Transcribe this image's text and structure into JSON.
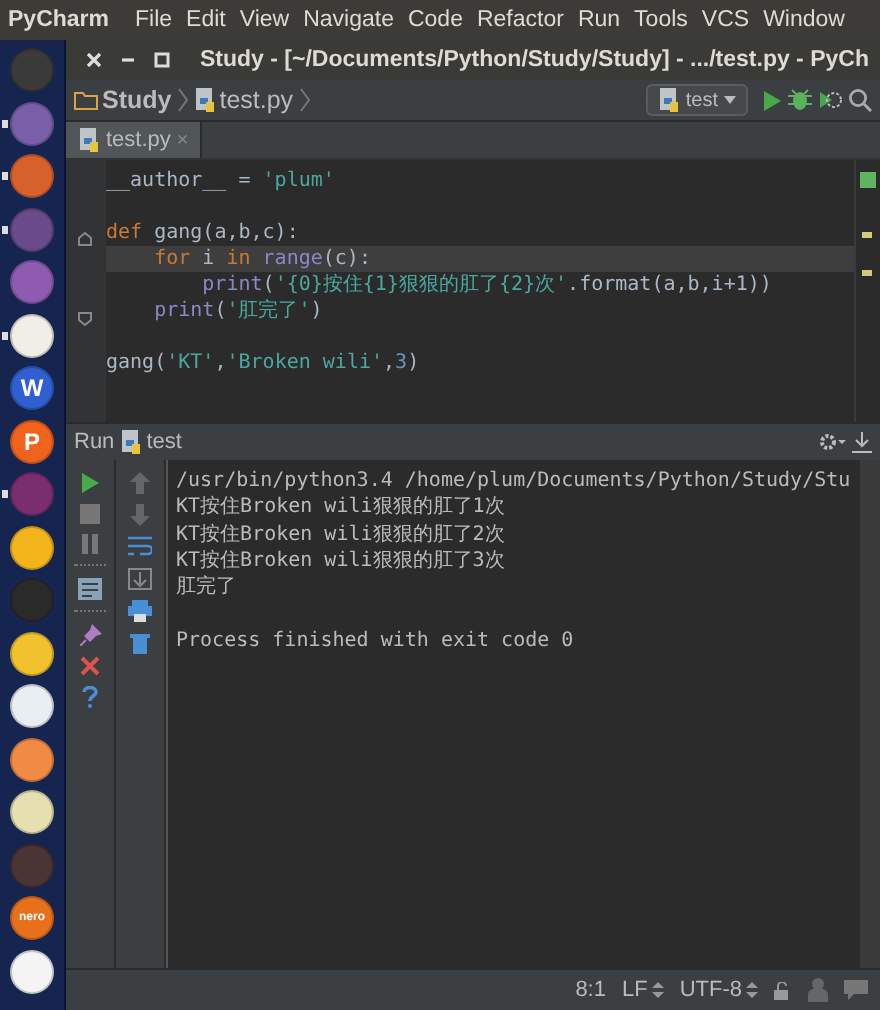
{
  "menu_bar": {
    "app": "PyCharm",
    "items": [
      "File",
      "Edit",
      "View",
      "Navigate",
      "Code",
      "Refactor",
      "Run",
      "Tools",
      "VCS",
      "Window"
    ]
  },
  "launcher": [
    {
      "color": "#3a3a3a",
      "running": false
    },
    {
      "color": "#7a5fa8",
      "running": true
    },
    {
      "color": "#d8602a",
      "running": true
    },
    {
      "color": "#6a4a8a",
      "running": true
    },
    {
      "color": "#8e5bb0",
      "running": false
    },
    {
      "color": "#efefe6",
      "running": true
    },
    {
      "color": "#2f5fd0",
      "glyph": "W",
      "running": false
    },
    {
      "color": "#f0631c",
      "glyph": "P",
      "running": false
    },
    {
      "color": "#7a2e6e",
      "running": true
    },
    {
      "color": "#f3b51c",
      "running": false
    },
    {
      "color": "#2a2a2a",
      "running": false
    },
    {
      "color": "#f2c12e",
      "running": false
    },
    {
      "color": "#e8eef2",
      "running": false
    },
    {
      "color": "#f08a44",
      "running": false
    },
    {
      "color": "#e6dfb0",
      "running": false
    },
    {
      "color": "#4a3434",
      "running": false
    },
    {
      "color": "#e8701a",
      "glyph": "nero",
      "running": false
    },
    {
      "color": "#f4f4f4",
      "running": false
    }
  ],
  "window": {
    "title": "Study - [~/Documents/Python/Study/Study] - .../test.py - PyCh"
  },
  "breadcrumbs": [
    "Study",
    "test.py"
  ],
  "run_config": "test",
  "tabs": [
    {
      "label": "test.py",
      "close": "×",
      "selected": true
    }
  ],
  "editor": {
    "blocks": [
      [
        {
          "current": false,
          "tokens": [
            {
              "kind": "plain",
              "text": "__author__ = "
            },
            {
              "kind": "string",
              "text": "'plum'"
            }
          ]
        }
      ],
      [
        {
          "current": false,
          "tokens": [
            {
              "kind": "keyword",
              "text": "def "
            },
            {
              "kind": "plain",
              "text": "gang(a,b,c):"
            }
          ]
        },
        {
          "current": true,
          "tokens": [
            {
              "kind": "keyword",
              "text": "    for "
            },
            {
              "kind": "plain",
              "text": "i "
            },
            {
              "kind": "keyword",
              "text": "in "
            },
            {
              "kind": "builtin",
              "text": "range"
            },
            {
              "kind": "plain",
              "text": "(c):"
            }
          ]
        },
        {
          "current": false,
          "tokens": [
            {
              "kind": "builtin",
              "text": "        print"
            },
            {
              "kind": "plain",
              "text": "("
            },
            {
              "kind": "string",
              "text": "'{0}按住{1}狠狠的肛了{2}次'"
            },
            {
              "kind": "plain",
              "text": ".format(a,b,i+1))"
            }
          ]
        },
        {
          "current": false,
          "tokens": [
            {
              "kind": "builtin",
              "text": "    print"
            },
            {
              "kind": "plain",
              "text": "("
            },
            {
              "kind": "string",
              "text": "'肛完了'"
            },
            {
              "kind": "plain",
              "text": ")"
            }
          ]
        }
      ],
      [
        {
          "current": false,
          "tokens": [
            {
              "kind": "plain",
              "text": "gang("
            },
            {
              "kind": "string",
              "text": "'KT'"
            },
            {
              "kind": "plain",
              "text": ","
            },
            {
              "kind": "string",
              "text": "'Broken wili'"
            },
            {
              "kind": "plain",
              "text": ","
            },
            {
              "kind": "number",
              "text": "3"
            },
            {
              "kind": "plain",
              "text": ")"
            }
          ]
        }
      ]
    ]
  },
  "run_panel": {
    "label": "Run",
    "config": "test",
    "output_blocks": [
      [
        "/usr/bin/python3.4 /home/plum/Documents/Python/Study/Stu",
        "KT按住Broken wili狠狠的肛了1次",
        "KT按住Broken wili狠狠的肛了2次",
        "KT按住Broken wili狠狠的肛了3次",
        "肛完了"
      ],
      [
        "Process finished with exit code 0"
      ]
    ]
  },
  "status_bar": {
    "position": "8:1",
    "line_separator": "LF",
    "encoding": "UTF-8"
  }
}
